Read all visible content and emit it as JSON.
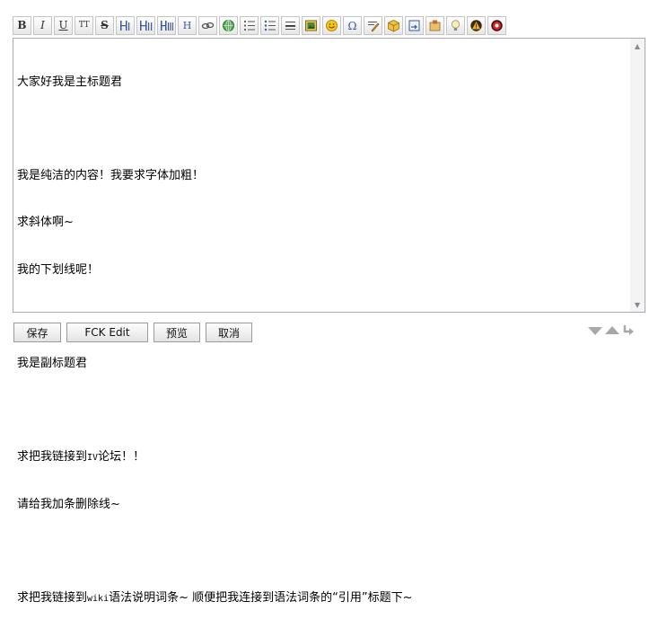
{
  "toolbar": {
    "bold": "B",
    "italic": "I",
    "underline": "U",
    "teletype": "TT",
    "strike": "S",
    "heading": "H"
  },
  "content": {
    "line1": "大家好我是主标题君",
    "line2": "我是纯洁的内容！我要求字体加粗！",
    "line3": "求斜体啊~",
    "line4": "我的下划线呢！",
    "line5": "我是副标题君",
    "line6_a": "求把我链接到",
    "line6_b": "IV",
    "line6_c": "论坛！！",
    "line7": "请给我加条删除线~",
    "line8_a": "求把我链接到",
    "line8_b": "wiki",
    "line8_c": "语法说明词条~ 顺便把我连接到语法词条的“引用”标题下~"
  },
  "buttons": {
    "save": "保存",
    "fck_edit": "FCK Edit",
    "preview": "预览",
    "cancel": "取消"
  },
  "colors": {
    "border": "#a5acb5",
    "toolbar_border": "#c5c5c5",
    "heading_blue": "#3a5a9a"
  }
}
